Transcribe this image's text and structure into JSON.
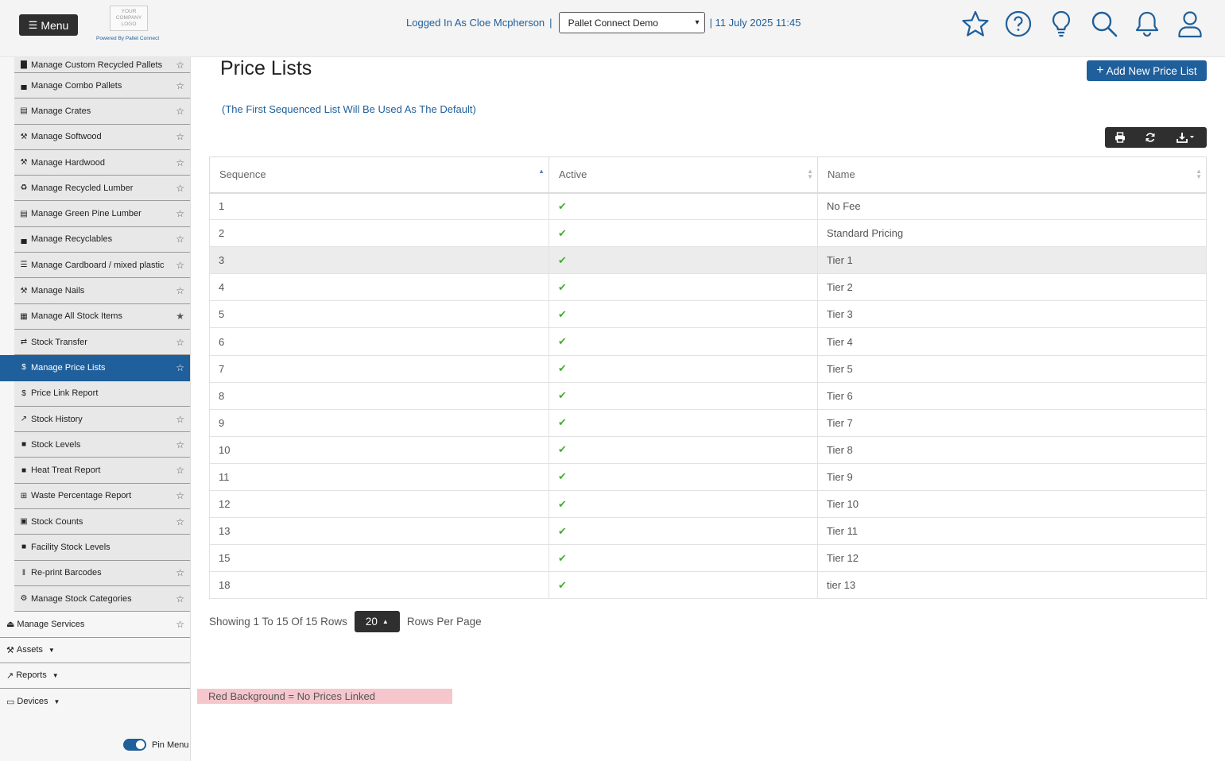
{
  "header": {
    "menu_label": "Menu",
    "logo_text": "YOUR COMPANY LOGO",
    "powered_by": "Powered By Pallet Connect",
    "logged_in": "Logged In As Cloe Mcpherson",
    "separator": "|",
    "org_selected": "Pallet Connect Demo",
    "datetime": "| 11 July 2025 11:45",
    "icons": [
      "star-icon",
      "help-icon",
      "lightbulb-icon",
      "search-icon",
      "bell-icon",
      "user-icon"
    ]
  },
  "sidebar": {
    "sub_items": [
      {
        "icon": "pallet",
        "label": "Manage Custom Recycled Pallets",
        "starred": false
      },
      {
        "icon": "combo",
        "label": "Manage Combo Pallets",
        "starred": false
      },
      {
        "icon": "crate",
        "label": "Manage Crates",
        "starred": false
      },
      {
        "icon": "hammer",
        "label": "Manage Softwood",
        "starred": false
      },
      {
        "icon": "hammer",
        "label": "Manage Hardwood",
        "starred": false
      },
      {
        "icon": "recycle",
        "label": "Manage Recycled Lumber",
        "starred": false
      },
      {
        "icon": "crate",
        "label": "Manage Green Pine Lumber",
        "starred": false
      },
      {
        "icon": "combo",
        "label": "Manage Recyclables",
        "starred": false
      },
      {
        "icon": "list",
        "label": "Manage Cardboard / mixed plastic",
        "starred": false
      },
      {
        "icon": "tools",
        "label": "Manage Nails",
        "starred": false
      },
      {
        "icon": "warehouse",
        "label": "Manage All Stock Items",
        "starred": true
      },
      {
        "icon": "shuffle",
        "label": "Stock Transfer",
        "starred": false
      },
      {
        "icon": "dollar",
        "label": "Manage Price Lists",
        "starred": false,
        "active": true
      },
      {
        "icon": "dollar",
        "label": "Price Link Report",
        "starred": null
      },
      {
        "icon": "chart",
        "label": "Stock History",
        "starred": false
      },
      {
        "icon": "file",
        "label": "Stock Levels",
        "starred": false
      },
      {
        "icon": "file",
        "label": "Heat Treat Report",
        "starred": false
      },
      {
        "icon": "table",
        "label": "Waste Percentage Report",
        "starred": false
      },
      {
        "icon": "boxes",
        "label": "Stock Counts",
        "starred": false
      },
      {
        "icon": "file",
        "label": "Facility Stock Levels",
        "starred": null
      },
      {
        "icon": "barcode",
        "label": "Re-print Barcodes",
        "starred": false
      },
      {
        "icon": "cogs",
        "label": "Manage Stock Categories",
        "starred": false
      }
    ],
    "top_items": [
      {
        "icon": "eject",
        "label": "Manage Services",
        "starred": false,
        "dropdown": false
      },
      {
        "icon": "tools",
        "label": "Assets",
        "dropdown": true
      },
      {
        "icon": "chart",
        "label": "Reports",
        "dropdown": true
      },
      {
        "icon": "monitor",
        "label": "Devices",
        "dropdown": true
      }
    ],
    "pin_label": "Pin Menu",
    "pin_on": true
  },
  "main": {
    "title": "Price Lists",
    "add_button": "Add New Price List",
    "hint": "(The First Sequenced List Will Be Used As The Default)",
    "toolbar": [
      "print-icon",
      "refresh-icon",
      "download-icon"
    ],
    "columns": [
      "Sequence",
      "Active",
      "Name"
    ],
    "sort_column": "Sequence",
    "rows": [
      {
        "seq": "1",
        "active": true,
        "name": "No Fee"
      },
      {
        "seq": "2",
        "active": true,
        "name": "Standard Pricing"
      },
      {
        "seq": "3",
        "active": true,
        "name": "Tier 1"
      },
      {
        "seq": "4",
        "active": true,
        "name": "Tier 2"
      },
      {
        "seq": "5",
        "active": true,
        "name": "Tier 3"
      },
      {
        "seq": "6",
        "active": true,
        "name": "Tier 4"
      },
      {
        "seq": "7",
        "active": true,
        "name": "Tier 5"
      },
      {
        "seq": "8",
        "active": true,
        "name": "Tier 6"
      },
      {
        "seq": "9",
        "active": true,
        "name": "Tier 7"
      },
      {
        "seq": "10",
        "active": true,
        "name": "Tier 8"
      },
      {
        "seq": "11",
        "active": true,
        "name": "Tier 9"
      },
      {
        "seq": "12",
        "active": true,
        "name": "Tier 10"
      },
      {
        "seq": "13",
        "active": true,
        "name": "Tier 11"
      },
      {
        "seq": "15",
        "active": true,
        "name": "Tier 12"
      },
      {
        "seq": "18",
        "active": true,
        "name": "tier 13"
      }
    ],
    "highlighted_row": 2,
    "pager": {
      "showing": "Showing 1 To 15 Of 15 Rows",
      "per_page": "20",
      "per_page_label": "Rows Per Page"
    },
    "legend": "Red Background = No Prices Linked"
  },
  "colors": {
    "brand": "#1f5f9b",
    "dark_button": "#2f2f2f",
    "check": "#4caa3a",
    "legend_bg": "#f5c6cc"
  }
}
